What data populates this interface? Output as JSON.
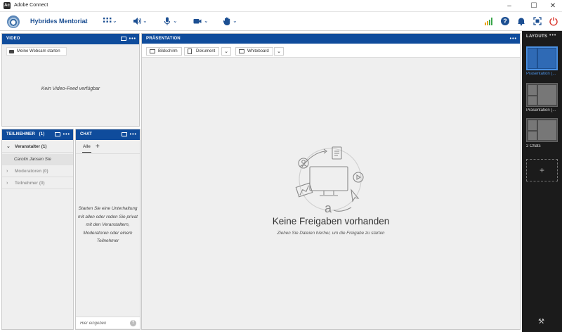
{
  "window": {
    "app_title": "Adobe Connect",
    "icon_letter": "Ac"
  },
  "toolbar": {
    "meeting_title": "Hybrides Mentoriat"
  },
  "pods": {
    "video": {
      "title": "VIDEO",
      "webcam_button": "Meine Webcam starten",
      "empty_text": "Kein Video-Feed verfügbar"
    },
    "attendees": {
      "title": "TEILNEHMER",
      "count": "(1)",
      "groups": [
        {
          "label": "Veranstalter (1)",
          "expanded": true
        },
        {
          "label": "Moderatoren (0)",
          "expanded": false
        },
        {
          "label": "Teilnehmer (0)",
          "expanded": false
        }
      ],
      "user": "Carolin Jansen Sie"
    },
    "chat": {
      "title": "CHAT",
      "tab_all": "Alle",
      "empty_text": "Starten Sie eine Unterhaltung mit allen oder reden Sie privat mit den Veranstaltern, Moderatoren oder einem Teilnehmer",
      "input_placeholder": "Hier eingeben",
      "help": "?"
    },
    "presentation": {
      "title": "PRÄSENTATION",
      "btn_screen": "Bildschirm",
      "btn_document": "Dokument",
      "btn_whiteboard": "Whiteboard",
      "empty_title": "Keine Freigaben vorhanden",
      "empty_subtitle": "Ziehen Sie Dateien hierher, um die Freigabe zu starten"
    }
  },
  "layouts": {
    "title": "LAYOUTS",
    "items": [
      {
        "label": "Präsentation (...",
        "active": true
      },
      {
        "label": "Präsentation (...",
        "active": false
      },
      {
        "label": "2 Chats",
        "active": false
      }
    ],
    "add": "+"
  },
  "colors": {
    "header_blue": "#0f4c9c",
    "accent": "#1c4f92",
    "active_layout": "#4a90e2",
    "power_red": "#d9342b"
  }
}
